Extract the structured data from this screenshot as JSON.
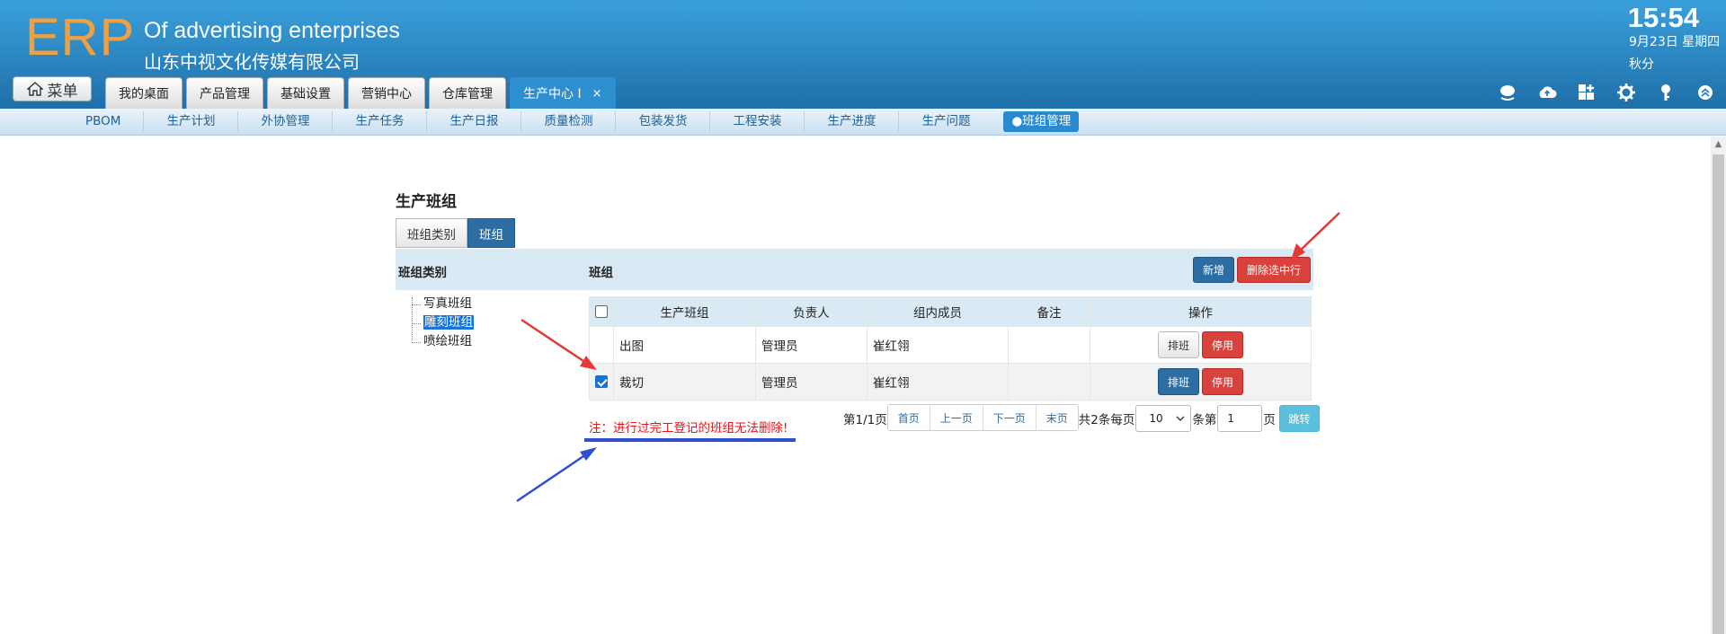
{
  "header": {
    "logo": "ERP",
    "company_en": "Of advertising enterprises",
    "company_cn": "山东中视文化传媒有限公司",
    "time": "15:54",
    "date": "9月23日 星期四",
    "solar_term": "秋分",
    "menu_label": "菜单",
    "tabs": [
      {
        "label": "我的桌面"
      },
      {
        "label": "产品管理"
      },
      {
        "label": "基础设置"
      },
      {
        "label": "营销中心"
      },
      {
        "label": "仓库管理"
      },
      {
        "label": "生产中心 I",
        "active": true,
        "close": "×"
      }
    ],
    "icons": [
      "chat-icon",
      "cloud-icon",
      "apps-icon",
      "gear-icon",
      "key-icon",
      "collapse-icon"
    ]
  },
  "subnav": {
    "items": [
      "PBOM",
      "生产计划",
      "外协管理",
      "生产任务",
      "生产日报",
      "质量检测",
      "包装发货",
      "工程安装",
      "生产进度",
      "生产问题"
    ],
    "active": "●班组管理"
  },
  "page": {
    "title": "生产班组",
    "tabs": [
      "班组类别",
      "班组"
    ],
    "left_title": "班组类别",
    "right_title": "班组",
    "new_button": "新增",
    "delete_button": "删除选中行",
    "tree": [
      "写真班组",
      "雕刻班组",
      "喷绘班组"
    ],
    "table": {
      "headers": [
        "生产班组",
        "负责人",
        "组内成员",
        "备注",
        "操作"
      ],
      "rows": [
        {
          "name": "出图",
          "leader": "管理员",
          "members": "崔红翎",
          "note": "",
          "checked": false
        },
        {
          "name": "裁切",
          "leader": "管理员",
          "members": "崔红翎",
          "note": "",
          "checked": true
        }
      ],
      "op_schedule": "排班",
      "op_disable": "停用"
    },
    "note": "注：进行过完工登记的班组无法删除!",
    "pager": {
      "page_info": "第1/1页",
      "first": "首页",
      "prev": "上一页",
      "next": "下一页",
      "last": "末页",
      "total": "共2条每页",
      "page_size": "10",
      "per_unit": "条第",
      "page_input": "1",
      "page_unit": "页",
      "go": "跳转"
    }
  },
  "colors": {
    "header_top": "#3aa0dc",
    "header_bottom": "#1f6fa8",
    "accent_blue": "#2c6ea3",
    "danger_red": "#d9413d",
    "note_red": "#e8141a",
    "annotation_red": "#e53935",
    "annotation_blue": "#2f4fd0"
  }
}
